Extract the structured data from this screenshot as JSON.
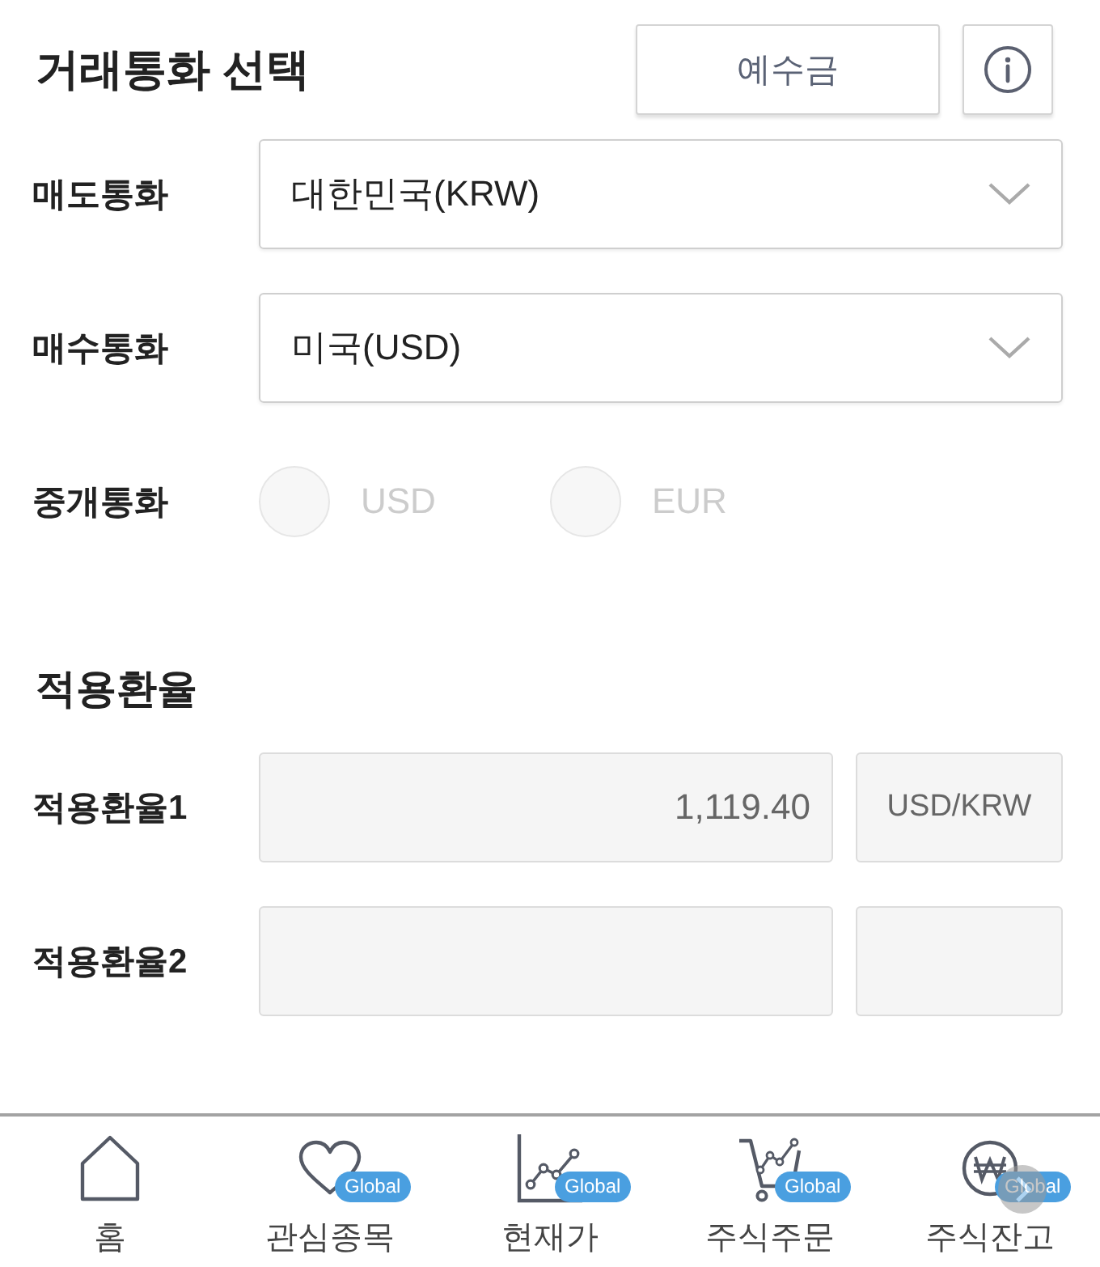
{
  "header": {
    "title": "거래통화 선택",
    "deposit_button": "예수금"
  },
  "currency_fields": [
    {
      "label": "매도통화",
      "kind": "select",
      "value": "대한민국(KRW)"
    },
    {
      "label": "매수통화",
      "kind": "select",
      "value": "미국(USD)"
    },
    {
      "label": "중개통화",
      "kind": "radio",
      "disabled": true,
      "options": [
        {
          "label": "USD",
          "selected": false
        },
        {
          "label": "EUR",
          "selected": false
        }
      ]
    }
  ],
  "rate_section": {
    "title": "적용환율",
    "rows": [
      {
        "label": "적용환율1",
        "value": "1,119.40",
        "unit": "USD/KRW"
      },
      {
        "label": "적용환율2"
      }
    ]
  },
  "bottom_nav": [
    {
      "label": "홈",
      "selected": false
    },
    {
      "label": "관심종목",
      "badge": "Global",
      "selected": false
    },
    {
      "label": "현재가",
      "badge": "Global",
      "selected": false
    },
    {
      "label": "주식주문",
      "badge": "Global",
      "selected": false
    },
    {
      "label": "주식잔고",
      "badge": "Global",
      "selected": false
    }
  ]
}
